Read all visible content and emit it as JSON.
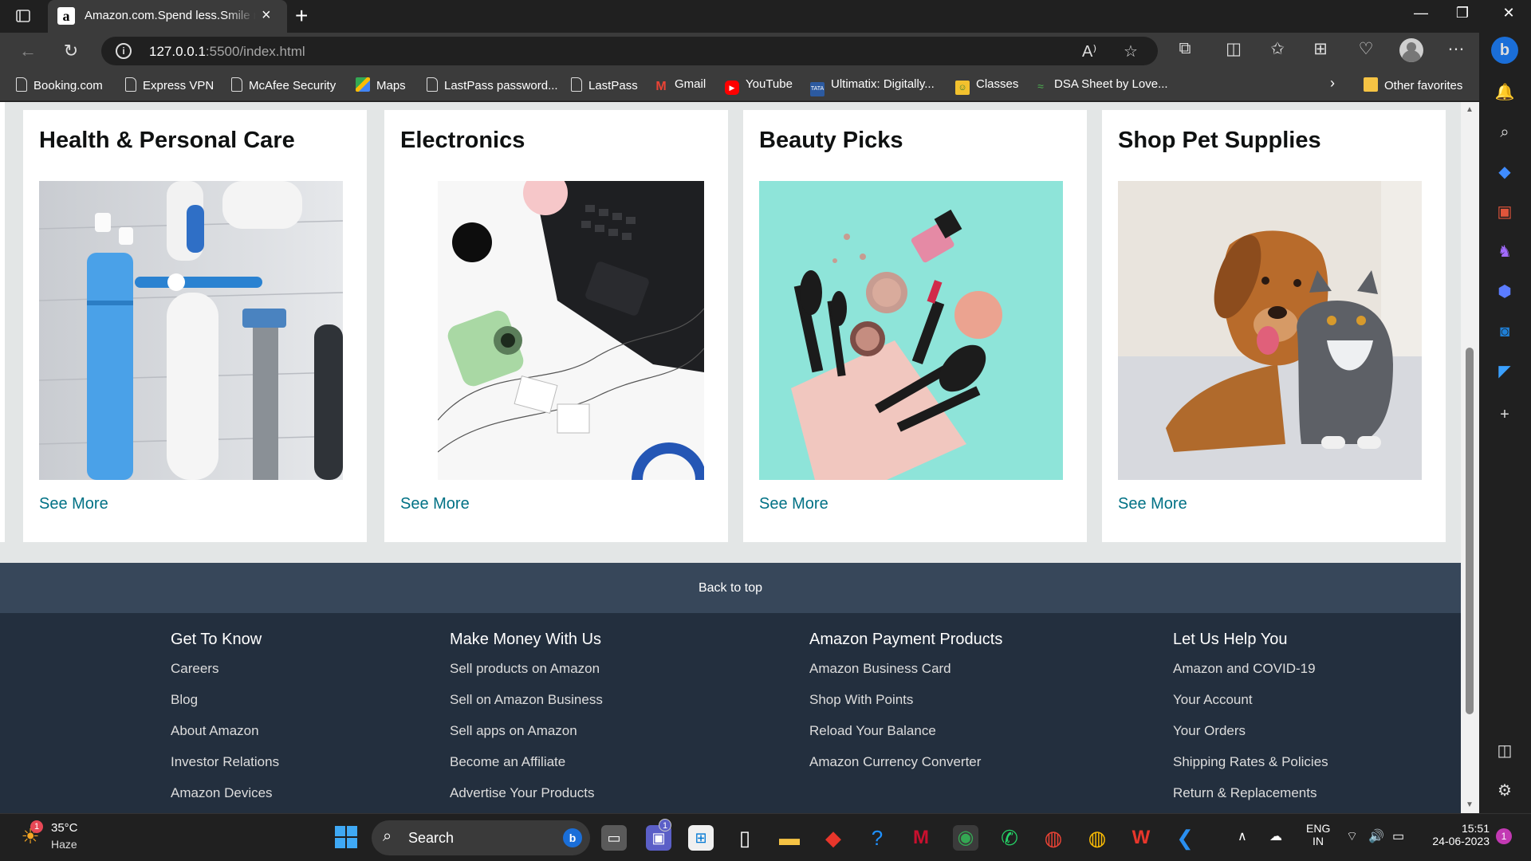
{
  "browser": {
    "tab_title": "Amazon.com.Spend less.Smile more.",
    "tab_favicon": "a",
    "url_host": "127.0.0.1",
    "url_rest": ":5500/index.html"
  },
  "bookmarks": [
    {
      "label": "Booking.com",
      "icon": "page"
    },
    {
      "label": "Express VPN",
      "icon": "page"
    },
    {
      "label": "McAfee Security",
      "icon": "page"
    },
    {
      "label": "Maps",
      "icon": "maps"
    },
    {
      "label": "LastPass password...",
      "icon": "page"
    },
    {
      "label": "LastPass",
      "icon": "page"
    },
    {
      "label": "Gmail",
      "icon": "gmail"
    },
    {
      "label": "YouTube",
      "icon": "youtube"
    },
    {
      "label": "Ultimatix: Digitally...",
      "icon": "tata"
    },
    {
      "label": "Classes",
      "icon": "classroom"
    },
    {
      "label": "DSA Sheet by Love...",
      "icon": "dsa"
    }
  ],
  "other_favorites": "Other favorites",
  "cards": [
    {
      "title": "Health & Personal Care",
      "link": "See More",
      "image": "health-products-photo"
    },
    {
      "title": "Electronics",
      "link": "See More",
      "image": "electronics-desk-photo"
    },
    {
      "title": "Beauty Picks",
      "link": "See More",
      "image": "makeup-brushes-photo"
    },
    {
      "title": "Shop Pet Supplies",
      "link": "See More",
      "image": "dog-and-cat-photo"
    }
  ],
  "back_to_top": "Back to top",
  "footer": {
    "columns": [
      {
        "heading": "Get To Know",
        "links": [
          "Careers",
          "Blog",
          "About Amazon",
          "Investor Relations",
          "Amazon Devices"
        ]
      },
      {
        "heading": "Make Money With Us",
        "links": [
          "Sell products on Amazon",
          "Sell on Amazon Business",
          "Sell apps on Amazon",
          "Become an Affiliate",
          "Advertise Your Products"
        ]
      },
      {
        "heading": "Amazon Payment Products",
        "links": [
          "Amazon Business Card",
          "Shop With Points",
          "Reload Your Balance",
          "Amazon Currency Converter"
        ]
      },
      {
        "heading": "Let Us Help You",
        "links": [
          "Amazon and COVID-19",
          "Your Account",
          "Your Orders",
          "Shipping Rates & Policies",
          "Return & Replacements"
        ]
      }
    ]
  },
  "taskbar": {
    "weather_temp": "35°C",
    "weather_desc": "Haze",
    "weather_badge": "1",
    "search_label": "Search",
    "teams_badge": "1",
    "lang_top": "ENG",
    "lang_bottom": "IN",
    "time": "15:51",
    "date": "24-06-2023",
    "notif_count": "1"
  },
  "colors": {
    "link": "#007185",
    "footer_bg": "#232f3e",
    "backtop_bg": "#37475a",
    "page_bg": "#e3e6e6"
  }
}
